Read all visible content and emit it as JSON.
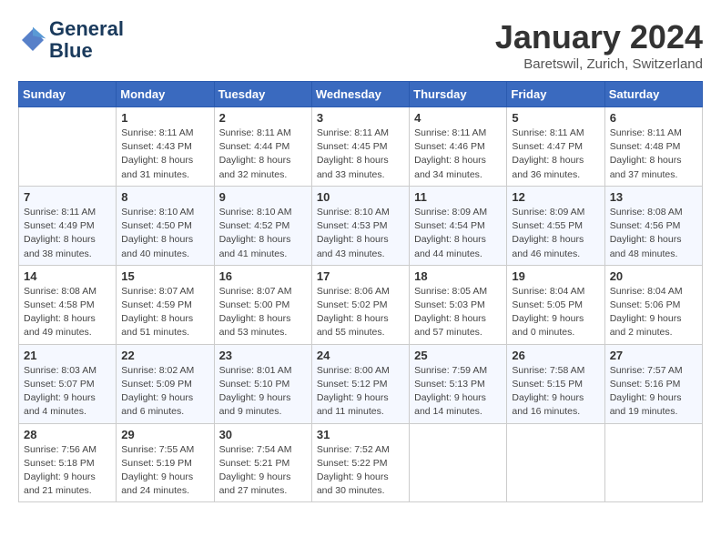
{
  "header": {
    "logo_line1": "General",
    "logo_line2": "Blue",
    "month_title": "January 2024",
    "location": "Baretswil, Zurich, Switzerland"
  },
  "weekdays": [
    "Sunday",
    "Monday",
    "Tuesday",
    "Wednesday",
    "Thursday",
    "Friday",
    "Saturday"
  ],
  "weeks": [
    [
      {
        "day": "",
        "sunrise": "",
        "sunset": "",
        "daylight": ""
      },
      {
        "day": "1",
        "sunrise": "Sunrise: 8:11 AM",
        "sunset": "Sunset: 4:43 PM",
        "daylight": "Daylight: 8 hours and 31 minutes."
      },
      {
        "day": "2",
        "sunrise": "Sunrise: 8:11 AM",
        "sunset": "Sunset: 4:44 PM",
        "daylight": "Daylight: 8 hours and 32 minutes."
      },
      {
        "day": "3",
        "sunrise": "Sunrise: 8:11 AM",
        "sunset": "Sunset: 4:45 PM",
        "daylight": "Daylight: 8 hours and 33 minutes."
      },
      {
        "day": "4",
        "sunrise": "Sunrise: 8:11 AM",
        "sunset": "Sunset: 4:46 PM",
        "daylight": "Daylight: 8 hours and 34 minutes."
      },
      {
        "day": "5",
        "sunrise": "Sunrise: 8:11 AM",
        "sunset": "Sunset: 4:47 PM",
        "daylight": "Daylight: 8 hours and 36 minutes."
      },
      {
        "day": "6",
        "sunrise": "Sunrise: 8:11 AM",
        "sunset": "Sunset: 4:48 PM",
        "daylight": "Daylight: 8 hours and 37 minutes."
      }
    ],
    [
      {
        "day": "7",
        "sunrise": "Sunrise: 8:11 AM",
        "sunset": "Sunset: 4:49 PM",
        "daylight": "Daylight: 8 hours and 38 minutes."
      },
      {
        "day": "8",
        "sunrise": "Sunrise: 8:10 AM",
        "sunset": "Sunset: 4:50 PM",
        "daylight": "Daylight: 8 hours and 40 minutes."
      },
      {
        "day": "9",
        "sunrise": "Sunrise: 8:10 AM",
        "sunset": "Sunset: 4:52 PM",
        "daylight": "Daylight: 8 hours and 41 minutes."
      },
      {
        "day": "10",
        "sunrise": "Sunrise: 8:10 AM",
        "sunset": "Sunset: 4:53 PM",
        "daylight": "Daylight: 8 hours and 43 minutes."
      },
      {
        "day": "11",
        "sunrise": "Sunrise: 8:09 AM",
        "sunset": "Sunset: 4:54 PM",
        "daylight": "Daylight: 8 hours and 44 minutes."
      },
      {
        "day": "12",
        "sunrise": "Sunrise: 8:09 AM",
        "sunset": "Sunset: 4:55 PM",
        "daylight": "Daylight: 8 hours and 46 minutes."
      },
      {
        "day": "13",
        "sunrise": "Sunrise: 8:08 AM",
        "sunset": "Sunset: 4:56 PM",
        "daylight": "Daylight: 8 hours and 48 minutes."
      }
    ],
    [
      {
        "day": "14",
        "sunrise": "Sunrise: 8:08 AM",
        "sunset": "Sunset: 4:58 PM",
        "daylight": "Daylight: 8 hours and 49 minutes."
      },
      {
        "day": "15",
        "sunrise": "Sunrise: 8:07 AM",
        "sunset": "Sunset: 4:59 PM",
        "daylight": "Daylight: 8 hours and 51 minutes."
      },
      {
        "day": "16",
        "sunrise": "Sunrise: 8:07 AM",
        "sunset": "Sunset: 5:00 PM",
        "daylight": "Daylight: 8 hours and 53 minutes."
      },
      {
        "day": "17",
        "sunrise": "Sunrise: 8:06 AM",
        "sunset": "Sunset: 5:02 PM",
        "daylight": "Daylight: 8 hours and 55 minutes."
      },
      {
        "day": "18",
        "sunrise": "Sunrise: 8:05 AM",
        "sunset": "Sunset: 5:03 PM",
        "daylight": "Daylight: 8 hours and 57 minutes."
      },
      {
        "day": "19",
        "sunrise": "Sunrise: 8:04 AM",
        "sunset": "Sunset: 5:05 PM",
        "daylight": "Daylight: 9 hours and 0 minutes."
      },
      {
        "day": "20",
        "sunrise": "Sunrise: 8:04 AM",
        "sunset": "Sunset: 5:06 PM",
        "daylight": "Daylight: 9 hours and 2 minutes."
      }
    ],
    [
      {
        "day": "21",
        "sunrise": "Sunrise: 8:03 AM",
        "sunset": "Sunset: 5:07 PM",
        "daylight": "Daylight: 9 hours and 4 minutes."
      },
      {
        "day": "22",
        "sunrise": "Sunrise: 8:02 AM",
        "sunset": "Sunset: 5:09 PM",
        "daylight": "Daylight: 9 hours and 6 minutes."
      },
      {
        "day": "23",
        "sunrise": "Sunrise: 8:01 AM",
        "sunset": "Sunset: 5:10 PM",
        "daylight": "Daylight: 9 hours and 9 minutes."
      },
      {
        "day": "24",
        "sunrise": "Sunrise: 8:00 AM",
        "sunset": "Sunset: 5:12 PM",
        "daylight": "Daylight: 9 hours and 11 minutes."
      },
      {
        "day": "25",
        "sunrise": "Sunrise: 7:59 AM",
        "sunset": "Sunset: 5:13 PM",
        "daylight": "Daylight: 9 hours and 14 minutes."
      },
      {
        "day": "26",
        "sunrise": "Sunrise: 7:58 AM",
        "sunset": "Sunset: 5:15 PM",
        "daylight": "Daylight: 9 hours and 16 minutes."
      },
      {
        "day": "27",
        "sunrise": "Sunrise: 7:57 AM",
        "sunset": "Sunset: 5:16 PM",
        "daylight": "Daylight: 9 hours and 19 minutes."
      }
    ],
    [
      {
        "day": "28",
        "sunrise": "Sunrise: 7:56 AM",
        "sunset": "Sunset: 5:18 PM",
        "daylight": "Daylight: 9 hours and 21 minutes."
      },
      {
        "day": "29",
        "sunrise": "Sunrise: 7:55 AM",
        "sunset": "Sunset: 5:19 PM",
        "daylight": "Daylight: 9 hours and 24 minutes."
      },
      {
        "day": "30",
        "sunrise": "Sunrise: 7:54 AM",
        "sunset": "Sunset: 5:21 PM",
        "daylight": "Daylight: 9 hours and 27 minutes."
      },
      {
        "day": "31",
        "sunrise": "Sunrise: 7:52 AM",
        "sunset": "Sunset: 5:22 PM",
        "daylight": "Daylight: 9 hours and 30 minutes."
      },
      {
        "day": "",
        "sunrise": "",
        "sunset": "",
        "daylight": ""
      },
      {
        "day": "",
        "sunrise": "",
        "sunset": "",
        "daylight": ""
      },
      {
        "day": "",
        "sunrise": "",
        "sunset": "",
        "daylight": ""
      }
    ]
  ]
}
